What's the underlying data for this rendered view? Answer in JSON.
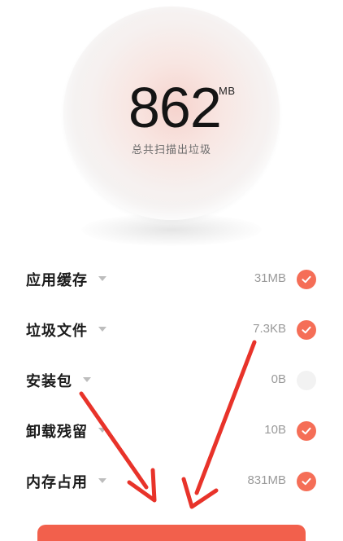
{
  "summary": {
    "size_value": "862",
    "size_unit": "MB",
    "label": "总共扫描出垃圾"
  },
  "items": [
    {
      "title": "应用缓存",
      "size": "31MB",
      "checked": true
    },
    {
      "title": "垃圾文件",
      "size": "7.3KB",
      "checked": true
    },
    {
      "title": "安装包",
      "size": "0B",
      "checked": false
    },
    {
      "title": "卸载残留",
      "size": "10B",
      "checked": true
    },
    {
      "title": "内存占用",
      "size": "831MB",
      "checked": true
    }
  ],
  "colors": {
    "accent": "#f56e57",
    "arrow": "#e8332a",
    "unchecked": "#f2f2f2"
  },
  "icons": {
    "expand": "chevron-down-icon",
    "check": "check-icon"
  }
}
